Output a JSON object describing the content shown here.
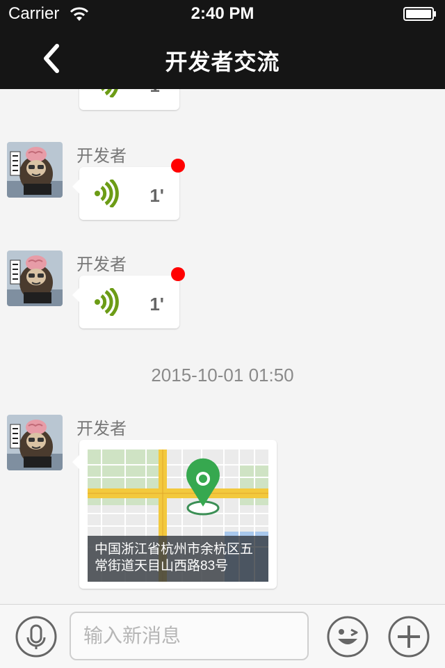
{
  "status_bar": {
    "carrier": "Carrier",
    "time": "2:40 PM"
  },
  "nav": {
    "title": "开发者交流",
    "back_icon": "chevron-left-icon"
  },
  "colors": {
    "nav_bg": "#151515",
    "unread": "#ff0000",
    "voice": "#6c9c16",
    "chat_bg": "#f4f4f4"
  },
  "messages": [
    {
      "type": "voice",
      "duration": "1'",
      "partial": true
    },
    {
      "type": "voice",
      "sender": "开发者",
      "duration": "1'",
      "unread": true
    },
    {
      "type": "voice",
      "sender": "开发者",
      "duration": "1'",
      "unread": true
    },
    {
      "type": "timestamp",
      "text": "2015-10-01 01:50"
    },
    {
      "type": "location",
      "sender": "开发者",
      "address": "中国浙江省杭州市余杭区五常街道天目山西路83号"
    }
  ],
  "input_bar": {
    "placeholder": "输入新消息",
    "mic_icon": "microphone-icon",
    "emoji_icon": "emoji-icon",
    "plus_icon": "plus-icon"
  }
}
